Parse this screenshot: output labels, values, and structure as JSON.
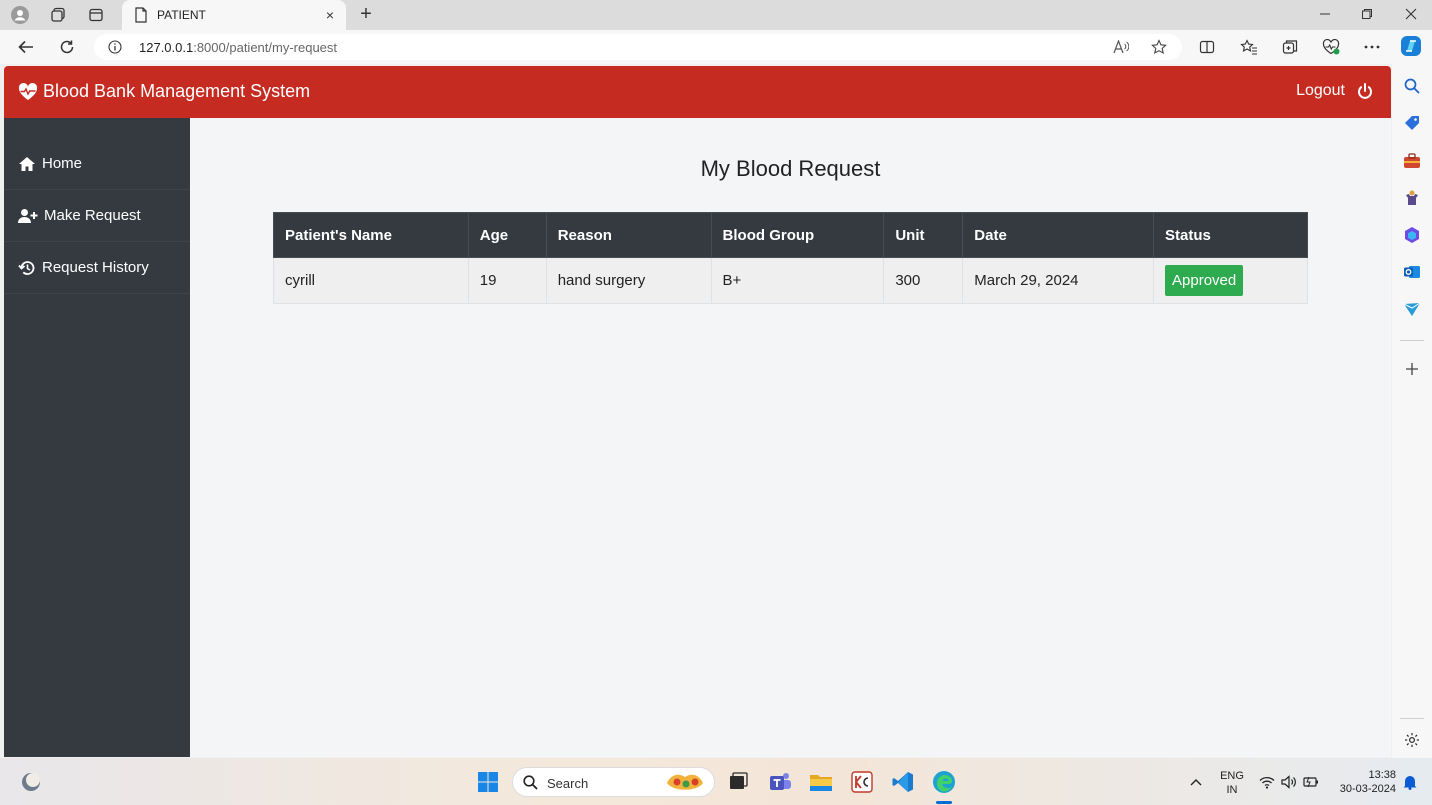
{
  "browser": {
    "tab_title": "PATIENT",
    "url_host": "127.0.0.1",
    "url_path": ":8000/patient/my-request",
    "new_tab": "+",
    "close_tab": "×"
  },
  "app": {
    "brand": "Blood Bank Management System",
    "logout": "Logout"
  },
  "sidebar": {
    "items": [
      {
        "label": "Home",
        "icon": "home-icon"
      },
      {
        "label": "Make Request",
        "icon": "user-plus-icon"
      },
      {
        "label": "Request History",
        "icon": "history-icon"
      }
    ]
  },
  "main": {
    "title": "My Blood Request",
    "table": {
      "headers": [
        "Patient's Name",
        "Age",
        "Reason",
        "Blood Group",
        "Unit",
        "Date",
        "Status"
      ],
      "rows": [
        [
          "cyrill",
          "19",
          "hand surgery",
          "B+",
          "300",
          "March 29, 2024",
          "Approved"
        ]
      ]
    }
  },
  "taskbar": {
    "search_label": "Search",
    "lang_line1": "ENG",
    "lang_line2": "IN",
    "time": "13:38",
    "date": "30-03-2024"
  },
  "colors": {
    "navbar": "#c62b22",
    "sidebar": "#343a40",
    "table_header": "#343a40",
    "badge_approved": "#2fab4f"
  }
}
